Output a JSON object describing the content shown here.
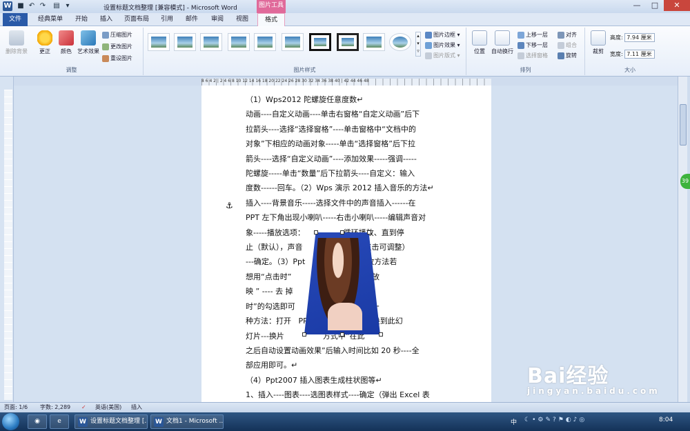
{
  "titlebar": {
    "doc_title": "设置标题文档整理 [兼容模式] - Microsoft Word",
    "picture_tools": "图片工具",
    "app_icon": "W"
  },
  "tabs": [
    "文件",
    "经典菜单",
    "开始",
    "插入",
    "页面布局",
    "引用",
    "邮件",
    "审阅",
    "视图",
    "格式"
  ],
  "ribbon": {
    "adjust": {
      "remove_bg": "删除背景",
      "corrections": "更正",
      "color": "颜色",
      "art_effects": "艺术效果",
      "compress": "压缩图片",
      "change": "更改图片",
      "reset": "重设图片",
      "label": "调整"
    },
    "styles": {
      "border": "图片边框",
      "effects": "图片效果",
      "layout": "图片版式",
      "label": "图片样式"
    },
    "arrange": {
      "position": "位置",
      "wrap": "自动换行",
      "forward": "上移一层",
      "backward": "下移一层",
      "selection": "选择窗格",
      "align": "对齐",
      "group": "组合",
      "rotate": "旋转",
      "label": "排列"
    },
    "size": {
      "crop": "裁剪",
      "height_label": "高度:",
      "height": "7.94 厘米",
      "width_label": "宽度:",
      "width": "7.11 厘米",
      "label": "大小"
    }
  },
  "ruler_numbers": "8 6 4 2 | 2 4 6 8 10 12 14 16 18 20 22 24 26 28 30 32 34 36 38 40 | 42 44 46 48",
  "document": {
    "lines": [
      "（1）Wps2012 陀螺旋任意度数↵",
      "动画----自定义动画----单击右窗格“自定义动画”后下",
      "拉箭头----选择“选择窗格”----单击窗格中“文档中的",
      "对象”下相应的动画对象-----单击“选择窗格”后下拉",
      "箭头----选择“自定义动画”----添加效果-----强调-----",
      "陀螺旋-----单击“数量”后下拉箭头----自定义：输入",
      "度数------回车。（2）Wps 演示 2012 插入音乐的方法↵",
      "插入----背景音乐-----选择文件中的声音插入------在",
      "PPT 左下角出现小喇叭-----右击小喇叭-----编辑声音对",
      "象-----播放选项：                循环播放、直到停",
      "止（默认），声音                音量（点击可调整）",
      "---确定。（3）Ppt                自动播放方法若",
      "想用“点击时”                就在“幻灯片放",
      "映 ” ---- 去 掉                “使用排练计",
      "时”的勾选即可                放映了。另一",
      "种方法：打开   PPT--- 动 画       ---切换到此幻",
      "灯片---换片                方式中“在此",
      "之后自动设置动画效果”后输入时间比如 20 秒----全",
      "部应用即可。↵",
      "（4）Ppt2007 插入图表生成柱状图等↵",
      "1、插入----图表----选图表样式----确定（弹出 Excel 表"
    ]
  },
  "side_badge": "39",
  "statusbar": {
    "page": "页面: 1/6",
    "words": "字数: 2,289",
    "lang": "英语(美国)",
    "mode": "插入"
  },
  "taskbar": {
    "item1": "设置标题文档整理 [...",
    "item2": "文档1 - Microsoft ...",
    "clock": "8:04",
    "ime": "中"
  },
  "watermark": {
    "brand": "Bai经验",
    "url": "jingyan.baidu.com"
  },
  "colors": {
    "file_tab": "#2a5aa8",
    "picture_tools": "#e06a9a",
    "picture_bg": "#2749b8"
  }
}
